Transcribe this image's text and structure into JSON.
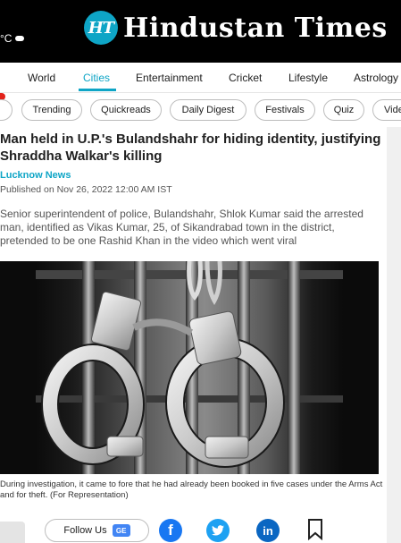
{
  "header": {
    "weather_unit": "°C",
    "logo_mark": "HT",
    "logo_text": "Hindustan Times"
  },
  "nav": {
    "items": [
      "World",
      "Cities",
      "Entertainment",
      "Cricket",
      "Lifestyle",
      "Astrology"
    ],
    "active": "Cities"
  },
  "chips": [
    "Trending",
    "Quickreads",
    "Daily Digest",
    "Festivals",
    "Quiz",
    "Vide"
  ],
  "article": {
    "headline": "Man held in U.P.'s Bulandshahr for hiding identity, justifying Shraddha Walkar's killing",
    "section": "Lucknow News",
    "published": "Published on Nov 26, 2022 12:00 AM IST",
    "summary": "Senior superintendent of police, Bulandshahr, Shlok Kumar said the arrested man, identified as Vikas Kumar, 25, of Sikandrabad town in the district, pretended to be one Rashid Khan in the video which went viral",
    "caption": "During investigation, it came to fore that he had already been booked in five cases under the Arms Act and for theft. (For Representation)"
  },
  "share": {
    "follow_label": "Follow Us",
    "gnews_label": "GE"
  },
  "colors": {
    "accent": "#0ea5c6",
    "facebook": "#1877f2",
    "twitter": "#1da1f2",
    "linkedin": "#0a66c2"
  },
  "icons": [
    "cloud-icon",
    "google-news-icon",
    "facebook-icon",
    "twitter-icon",
    "linkedin-icon",
    "bookmark-icon"
  ]
}
